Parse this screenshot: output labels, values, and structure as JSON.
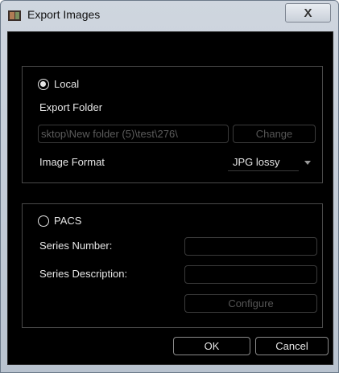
{
  "window": {
    "title": "Export Images",
    "close_symbol": "X"
  },
  "local": {
    "radio_label": "Local",
    "selected": true,
    "export_folder_label": "Export Folder",
    "export_folder_value": "sktop\\New folder (5)\\test\\276\\",
    "change_button": "Change",
    "image_format_label": "Image Format",
    "image_format_value": "JPG lossy"
  },
  "pacs": {
    "radio_label": "PACS",
    "selected": false,
    "series_number_label": "Series Number:",
    "series_number_value": "",
    "series_description_label": "Series Description:",
    "series_description_value": "",
    "configure_button": "Configure"
  },
  "footer": {
    "ok_button": "OK",
    "cancel_button": "Cancel"
  },
  "colors": {
    "client_bg": "#000000",
    "text": "#e6e6e6",
    "disabled_text": "#5c5c5c"
  },
  "icons": {
    "app": "export-app-icon",
    "close": "close-icon",
    "dropdown": "chevron-down-icon"
  }
}
